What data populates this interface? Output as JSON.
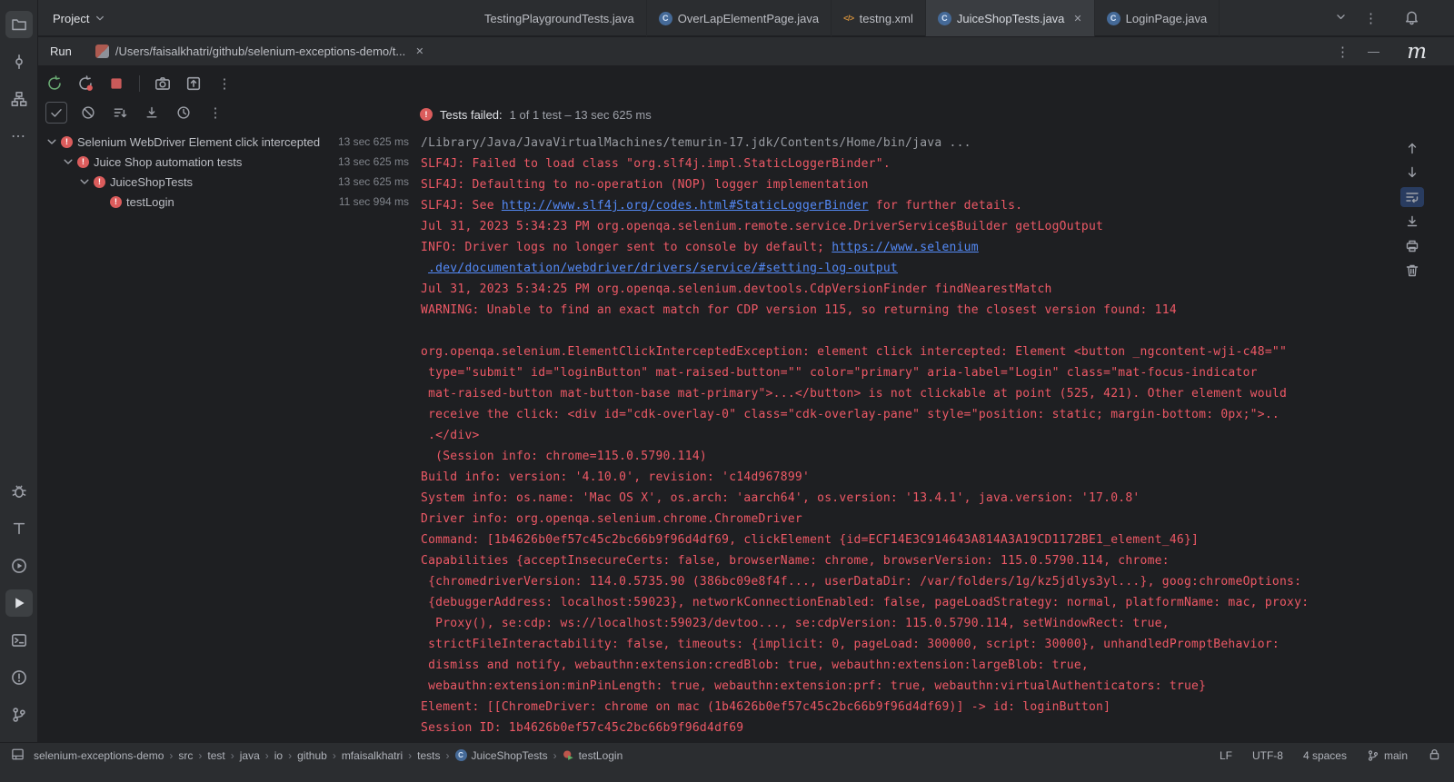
{
  "colors": {
    "background": "#1e1f22",
    "panel": "#2b2d30",
    "console_error": "#ee5966",
    "console_stdout": "#9a9da3",
    "link_blue": "#548af7",
    "error_badge": "#db5c5c",
    "run_green": "#6aab73",
    "stop_red": "#cb5a5a"
  },
  "glyphs": {
    "kebab": "⋮",
    "more_dots": "⋯",
    "close": "✕",
    "minimize": "—",
    "crumb_sep": "›",
    "bang": "!",
    "class_letter": "C",
    "xml": "</>"
  },
  "header": {
    "project_label": "Project",
    "corner_letter": "m"
  },
  "editor_tabs": [
    {
      "label": "TestingPlaygroundTests.java",
      "icon": null,
      "active": false,
      "closable": false
    },
    {
      "label": "OverLapElementPage.java",
      "icon": "class",
      "active": false,
      "closable": false
    },
    {
      "label": "testng.xml",
      "icon": "xml",
      "active": false,
      "closable": false
    },
    {
      "label": "JuiceShopTests.java",
      "icon": "class",
      "active": true,
      "closable": true
    },
    {
      "label": "LoginPage.java",
      "icon": "class",
      "active": false,
      "closable": false
    }
  ],
  "run_panel": {
    "tool_label": "Run",
    "config_tab": "/Users/faisalkhatri/github/selenium-exceptions-demo/t...",
    "summary_label": "Tests failed:",
    "summary_detail": "1 of 1 test – 13 sec 625 ms"
  },
  "test_tree": [
    {
      "label": "Selenium WebDriver Element click intercepted",
      "duration": "13 sec 625 ms",
      "indent": 0,
      "expandable": true
    },
    {
      "label": "Juice Shop automation tests",
      "duration": "13 sec 625 ms",
      "indent": 1,
      "expandable": true
    },
    {
      "label": "JuiceShopTests",
      "duration": "13 sec 625 ms",
      "indent": 2,
      "expandable": true
    },
    {
      "label": "testLogin",
      "duration": "11 sec 994 ms",
      "indent": 3,
      "expandable": false
    }
  ],
  "console": {
    "lines": [
      [
        {
          "s": "out",
          "t": "/Library/Java/JavaVirtualMachines/temurin-17.jdk/Contents/Home/bin/java ..."
        }
      ],
      [
        {
          "s": "err",
          "t": "SLF4J: Failed to load class \"org.slf4j.impl.StaticLoggerBinder\"."
        }
      ],
      [
        {
          "s": "err",
          "t": "SLF4J: Defaulting to no-operation (NOP) logger implementation"
        }
      ],
      [
        {
          "s": "err",
          "t": "SLF4J: See "
        },
        {
          "s": "link",
          "t": "http://www.slf4j.org/codes.html#StaticLoggerBinder"
        },
        {
          "s": "err",
          "t": " for further details."
        }
      ],
      [
        {
          "s": "err",
          "t": "Jul 31, 2023 5:34:23 PM org.openqa.selenium.remote.service.DriverService$Builder getLogOutput"
        }
      ],
      [
        {
          "s": "err",
          "t": "INFO: Driver logs no longer sent to console by default; "
        },
        {
          "s": "link",
          "t": "https://www.selenium"
        }
      ],
      [
        {
          "s": "err",
          "t": " "
        },
        {
          "s": "link",
          "t": ".dev/documentation/webdriver/drivers/service/#setting-log-output"
        }
      ],
      [
        {
          "s": "err",
          "t": "Jul 31, 2023 5:34:25 PM org.openqa.selenium.devtools.CdpVersionFinder findNearestMatch"
        }
      ],
      [
        {
          "s": "err",
          "t": "WARNING: Unable to find an exact match for CDP version 115, so returning the closest version found: 114"
        }
      ],
      [],
      [
        {
          "s": "err",
          "t": "org.openqa.selenium.ElementClickInterceptedException: element click intercepted: Element <button _ngcontent-wji-c48=\"\""
        }
      ],
      [
        {
          "s": "err",
          "t": " type=\"submit\" id=\"loginButton\" mat-raised-button=\"\" color=\"primary\" aria-label=\"Login\" class=\"mat-focus-indicator"
        }
      ],
      [
        {
          "s": "err",
          "t": " mat-raised-button mat-button-base mat-primary\">...</button> is not clickable at point (525, 421). Other element would"
        }
      ],
      [
        {
          "s": "err",
          "t": " receive the click: <div id=\"cdk-overlay-0\" class=\"cdk-overlay-pane\" style=\"position: static; margin-bottom: 0px;\">.."
        }
      ],
      [
        {
          "s": "err",
          "t": " .</div>"
        }
      ],
      [
        {
          "s": "err",
          "t": "  (Session info: chrome=115.0.5790.114)"
        }
      ],
      [
        {
          "s": "err",
          "t": "Build info: version: '4.10.0', revision: 'c14d967899'"
        }
      ],
      [
        {
          "s": "err",
          "t": "System info: os.name: 'Mac OS X', os.arch: 'aarch64', os.version: '13.4.1', java.version: '17.0.8'"
        }
      ],
      [
        {
          "s": "err",
          "t": "Driver info: org.openqa.selenium.chrome.ChromeDriver"
        }
      ],
      [
        {
          "s": "err",
          "t": "Command: [1b4626b0ef57c45c2bc66b9f96d4df69, clickElement {id=ECF14E3C914643A814A3A19CD1172BE1_element_46}]"
        }
      ],
      [
        {
          "s": "err",
          "t": "Capabilities {acceptInsecureCerts: false, browserName: chrome, browserVersion: 115.0.5790.114, chrome:"
        }
      ],
      [
        {
          "s": "err",
          "t": " {chromedriverVersion: 114.0.5735.90 (386bc09e8f4f..., userDataDir: /var/folders/1g/kz5jdlys3yl...}, goog:chromeOptions:"
        }
      ],
      [
        {
          "s": "err",
          "t": " {debuggerAddress: localhost:59023}, networkConnectionEnabled: false, pageLoadStrategy: normal, platformName: mac, proxy:"
        }
      ],
      [
        {
          "s": "err",
          "t": "  Proxy(), se:cdp: ws://localhost:59023/devtoo..., se:cdpVersion: 115.0.5790.114, setWindowRect: true,"
        }
      ],
      [
        {
          "s": "err",
          "t": " strictFileInteractability: false, timeouts: {implicit: 0, pageLoad: 300000, script: 30000}, unhandledPromptBehavior:"
        }
      ],
      [
        {
          "s": "err",
          "t": " dismiss and notify, webauthn:extension:credBlob: true, webauthn:extension:largeBlob: true,"
        }
      ],
      [
        {
          "s": "err",
          "t": " webauthn:extension:minPinLength: true, webauthn:extension:prf: true, webauthn:virtualAuthenticators: true}"
        }
      ],
      [
        {
          "s": "err",
          "t": "Element: [[ChromeDriver: chrome on mac (1b4626b0ef57c45c2bc66b9f96d4df69)] -> id: loginButton]"
        }
      ],
      [
        {
          "s": "err",
          "t": "Session ID: 1b4626b0ef57c45c2bc66b9f96d4df69"
        }
      ]
    ]
  },
  "status_bar": {
    "breadcrumbs": [
      {
        "label": "selenium-exceptions-demo"
      },
      {
        "label": "src"
      },
      {
        "label": "test"
      },
      {
        "label": "java"
      },
      {
        "label": "io"
      },
      {
        "label": "github"
      },
      {
        "label": "mfaisalkhatri"
      },
      {
        "label": "tests"
      },
      {
        "label": "JuiceShopTests",
        "icon": "class"
      },
      {
        "label": "testLogin",
        "icon": "test"
      }
    ],
    "line_separator": "LF",
    "encoding": "UTF-8",
    "indent": "4 spaces",
    "branch": "main"
  }
}
